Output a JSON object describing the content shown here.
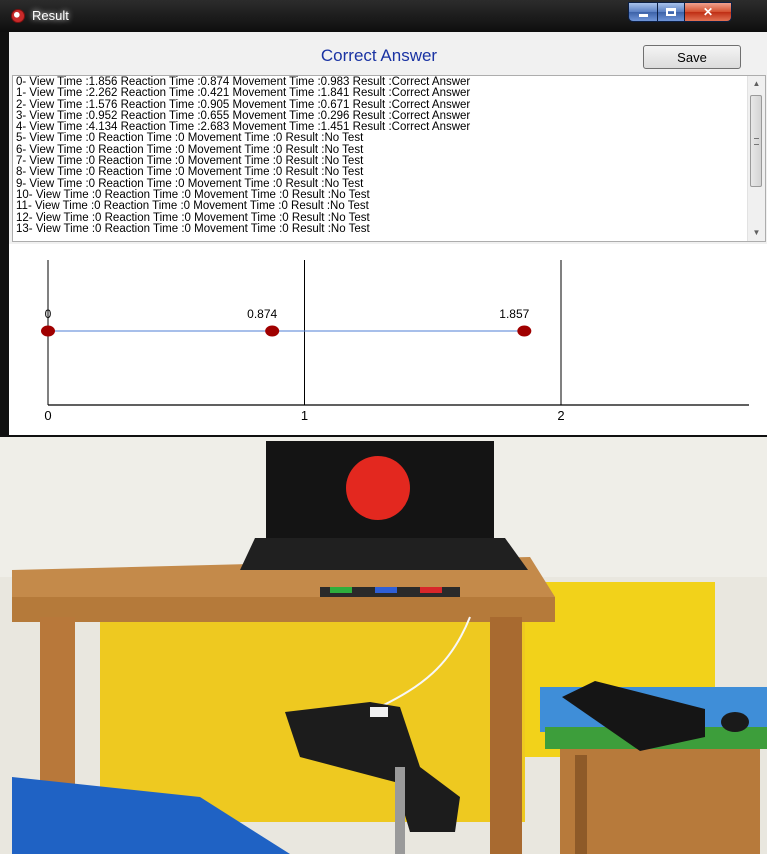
{
  "window": {
    "title": "Result",
    "answer_title": "Correct Answer",
    "save_label": "Save",
    "colors": {
      "title_text": "#1a33a3",
      "point": "#a00000",
      "line": "#4f7fd6"
    }
  },
  "log": [
    "0- View Time :1.856  Reaction Time :0.874  Movement Time :0.983  Result :Correct Answer",
    "1- View Time :2.262  Reaction Time :0.421  Movement Time :1.841  Result :Correct Answer",
    "2- View Time :1.576  Reaction Time :0.905  Movement Time :0.671  Result :Correct Answer",
    "3- View Time :0.952  Reaction Time :0.655  Movement Time :0.296  Result :Correct Answer",
    "4- View Time :4.134  Reaction Time :2.683  Movement Time :1.451  Result :Correct Answer",
    "5- View Time :0  Reaction Time :0  Movement Time :0  Result :No Test",
    "6- View Time :0  Reaction Time :0  Movement Time :0  Result :No Test",
    "7- View Time :0  Reaction Time :0  Movement Time :0  Result :No Test",
    "8- View Time :0  Reaction Time :0  Movement Time :0  Result :No Test",
    "9- View Time :0  Reaction Time :0  Movement Time :0  Result :No Test",
    "10-  View Time :0  Reaction Time :0  Movement Time :0  Result :No Test",
    "11-  View Time :0  Reaction Time :0  Movement Time :0  Result :No Test",
    "12-  View Time :0  Reaction Time :0  Movement Time :0  Result :No Test",
    "13-  View Time :0  Reaction Time :0  Movement Time :0  Result :No Test"
  ],
  "chart_data": {
    "type": "line",
    "x": [
      0,
      0.874,
      1.857
    ],
    "labels": [
      "0",
      "0.874",
      "1.857"
    ],
    "xticks": [
      "0",
      "1",
      "2"
    ],
    "xlim": [
      0,
      2.8
    ],
    "grid": true
  }
}
